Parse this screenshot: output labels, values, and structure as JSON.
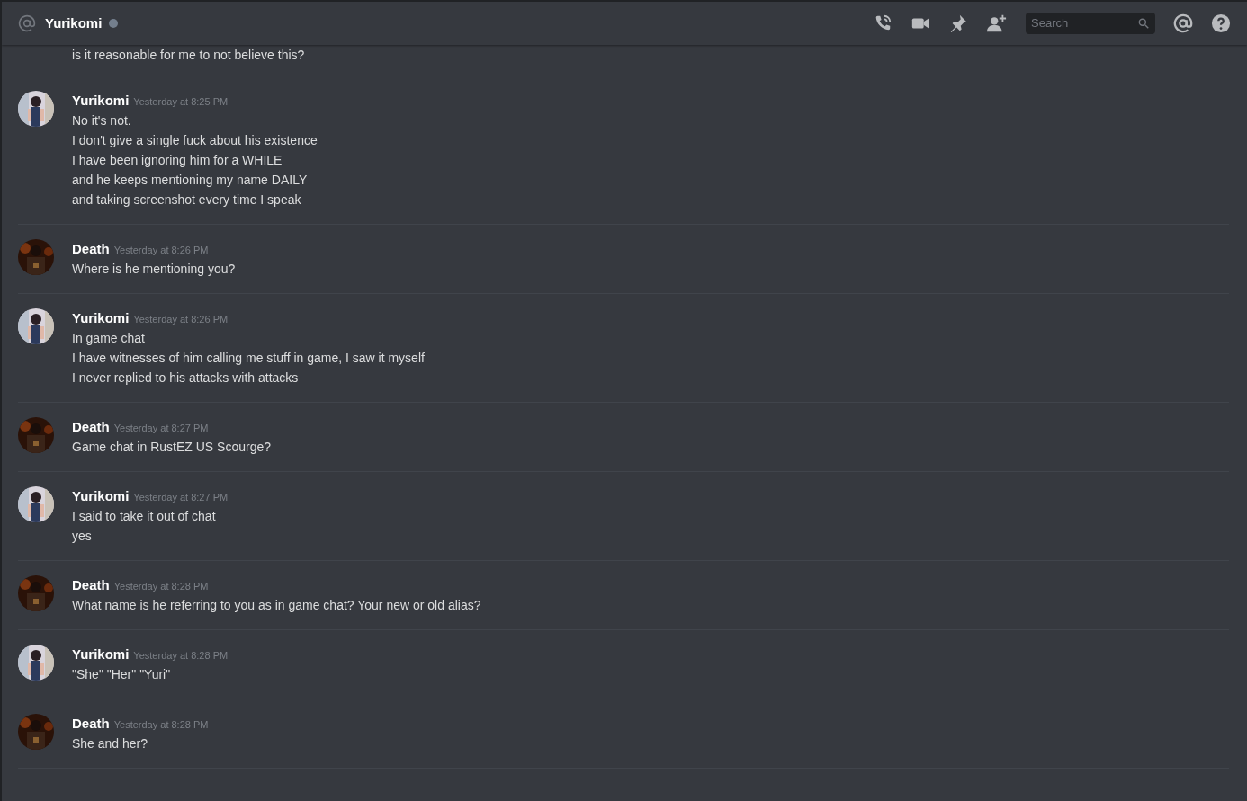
{
  "header": {
    "channel": "Yurikomi",
    "search": {
      "placeholder": "Search"
    }
  },
  "messages": [
    {
      "lines": [
        "is it reasonable for me to not believe this?"
      ]
    },
    {
      "author": "Yurikomi",
      "time": "Yesterday at 8:25 PM",
      "lines": [
        "No it's not.",
        "I don't give a single fuck about his existence",
        "I have been ignoring him for a WHILE",
        "and he keeps mentioning my name DAILY",
        "and taking screenshot every time I speak"
      ]
    },
    {
      "author": "Death",
      "time": "Yesterday at 8:26 PM",
      "lines": [
        "Where is he mentioning you?"
      ]
    },
    {
      "author": "Yurikomi",
      "time": "Yesterday at 8:26 PM",
      "lines": [
        "In game chat",
        "I have witnesses of him calling me stuff in game, I saw it myself",
        "I never replied to his attacks with attacks"
      ]
    },
    {
      "author": "Death",
      "time": "Yesterday at 8:27 PM",
      "lines": [
        "Game chat in RustEZ US Scourge?"
      ]
    },
    {
      "author": "Yurikomi",
      "time": "Yesterday at 8:27 PM",
      "lines": [
        "I said to take it out of chat",
        "yes"
      ]
    },
    {
      "author": "Death",
      "time": "Yesterday at 8:28 PM",
      "lines": [
        "What name is he referring to you as in game chat? Your new or old alias?"
      ]
    },
    {
      "author": "Yurikomi",
      "time": "Yesterday at 8:28 PM",
      "lines": [
        "\"She\" \"Her\" \"Yuri\""
      ]
    },
    {
      "author": "Death",
      "time": "Yesterday at 8:28 PM",
      "lines": [
        "She and her?"
      ]
    }
  ]
}
